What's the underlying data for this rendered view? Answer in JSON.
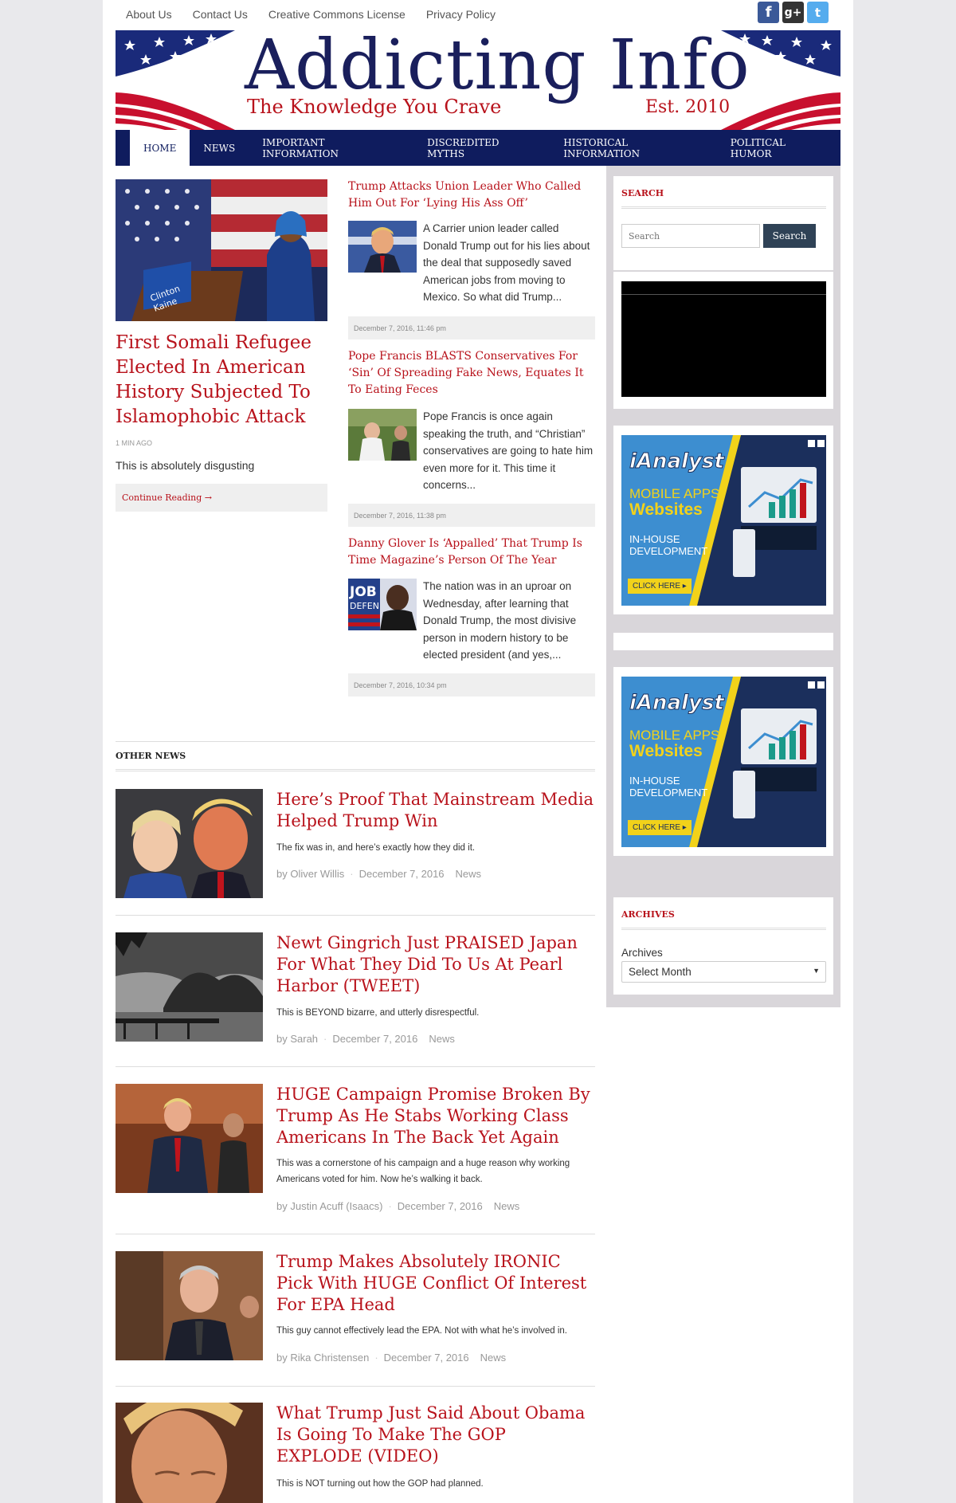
{
  "topbar": {
    "links": [
      "About Us",
      "Contact Us",
      "Creative Commons License",
      "Privacy Policy"
    ],
    "social": [
      "facebook-icon",
      "google-plus-icon",
      "twitter-icon"
    ]
  },
  "banner": {
    "title": "Addicting Info",
    "tagline": "The Knowledge You Crave",
    "established": "Est. 2010"
  },
  "nav": {
    "items": [
      "HOME",
      "NEWS",
      "IMPORTANT INFORMATION",
      "DISCREDITED MYTHS",
      "HISTORICAL INFORMATION",
      "POLITICAL HUMOR"
    ],
    "active": "HOME"
  },
  "featured": {
    "title": "First Somali Refugee Elected In American History Subjected To Islamophobic Attack",
    "time": "1 MIN AGO",
    "excerpt": "This is absolutely disgusting",
    "more": "Continue Reading →"
  },
  "mid_posts": [
    {
      "title": "Trump Attacks Union Leader Who Called Him Out For ‘Lying His Ass Off’",
      "excerpt": "A Carrier union leader called Donald Trump out for his lies about the deal that supposedly saved American jobs from moving to Mexico. So what did Trump...",
      "date": "December 7, 2016, 11:46 pm"
    },
    {
      "title": "Pope Francis BLASTS Conservatives For ‘Sin’ Of Spreading Fake News, Equates It To Eating Feces",
      "excerpt": "Pope Francis is once again speaking the truth, and “Christian” conservatives are going to hate him even more for it. This time it concerns...",
      "date": "December 7, 2016, 11:38 pm"
    },
    {
      "title": "Danny Glover Is ‘Appalled’ That Trump Is Time Magazine’s Person Of The Year",
      "excerpt": "The nation was in an uproar on Wednesday, after learning that Donald Trump, the most divisive person in modern history to be elected president (and yes,...",
      "date": "December 7, 2016, 10:34 pm"
    }
  ],
  "other_news": {
    "heading": "OTHER NEWS",
    "items": [
      {
        "title": "Here’s Proof That Mainstream Media Helped Trump Win",
        "excerpt": "The fix was in, and here’s exactly how they did it.",
        "author": "by Oliver Willis",
        "date": "December 7, 2016",
        "category": "News"
      },
      {
        "title": "Newt Gingrich Just PRAISED Japan For What They Did To Us At Pearl Harbor (TWEET)",
        "excerpt": "This is BEYOND bizarre, and utterly disrespectful.",
        "author": "by Sarah",
        "date": "December 7, 2016",
        "category": "News"
      },
      {
        "title": "HUGE Campaign Promise Broken By Trump As He Stabs Working Class Americans In The Back Yet Again",
        "excerpt": "This was a cornerstone of his campaign and a huge reason why working Americans voted for him. Now he’s walking it back.",
        "author": "by Justin Acuff (Isaacs)",
        "date": "December 7, 2016",
        "category": "News"
      },
      {
        "title": "Trump Makes Absolutely IRONIC Pick With HUGE Conflict Of Interest For EPA Head",
        "excerpt": "This guy cannot effectively lead the EPA. Not with what he’s involved in.",
        "author": "by Rika Christensen",
        "date": "December 7, 2016",
        "category": "News"
      },
      {
        "title": "What Trump Just Said About Obama Is Going To Make The GOP EXPLODE (VIDEO)",
        "excerpt": "This is NOT turning out how the GOP had planned.",
        "author": "",
        "date": "",
        "category": ""
      }
    ]
  },
  "sidebar": {
    "search_title": "SEARCH",
    "search_placeholder": "Search",
    "search_button": "Search",
    "ad": {
      "brand": "iAnalyst",
      "line1": "MOBILE APPS",
      "line2": "Websites",
      "line3": "IN-HOUSE",
      "line4": "DEVELOPMENT",
      "cta": "CLICK HERE ▸"
    },
    "archives_title": "ARCHIVES",
    "archives_label": "Archives",
    "archives_select": "Select Month"
  },
  "colors": {
    "brand_red": "#b8121b",
    "nav_navy": "#0f1c5e",
    "search_button": "#2f4256"
  }
}
